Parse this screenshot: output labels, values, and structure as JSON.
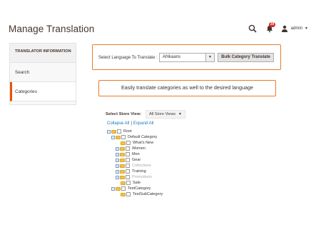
{
  "page": {
    "title": "Manage Translation"
  },
  "header": {
    "notifications_count": "39",
    "user_name": "admin"
  },
  "sidebar": {
    "heading": "TRANSLATOR INFORMATION",
    "items": [
      {
        "label": "Search",
        "active": false
      },
      {
        "label": "Categories",
        "active": true
      }
    ]
  },
  "language_panel": {
    "label": "Select Language To Translate :",
    "selected_language": "Afrikaans",
    "bulk_button_label": "Bulk Category Translate"
  },
  "caption": "Easily translate categories as well to the desired language",
  "store_view": {
    "label": "Select Store View:",
    "selected": "All Store Views"
  },
  "tree_links": {
    "collapse": "Collapse All",
    "separator": "|",
    "expand": "Expand All"
  },
  "tree": {
    "nodes": [
      {
        "label": "Root",
        "muted": false
      },
      {
        "label": "Default Category",
        "muted": false
      },
      {
        "label": "What's New",
        "muted": false
      },
      {
        "label": "Women",
        "muted": false
      },
      {
        "label": "Men",
        "muted": false
      },
      {
        "label": "Gear",
        "muted": false
      },
      {
        "label": "Collections",
        "muted": true
      },
      {
        "label": "Training",
        "muted": false
      },
      {
        "label": "Promotions",
        "muted": true
      },
      {
        "label": "Sale",
        "muted": false
      },
      {
        "label": "TestCategory",
        "muted": false
      },
      {
        "label": "TestSubCategory",
        "muted": false
      }
    ]
  },
  "colors": {
    "accent": "#eb5202",
    "highlight_border": "#e87a2f",
    "link": "#1979c3",
    "badge": "#e22626"
  },
  "icons": [
    "search-icon",
    "bell-icon",
    "user-icon",
    "chevron-down-icon",
    "folder-icon",
    "expand-icon"
  ]
}
